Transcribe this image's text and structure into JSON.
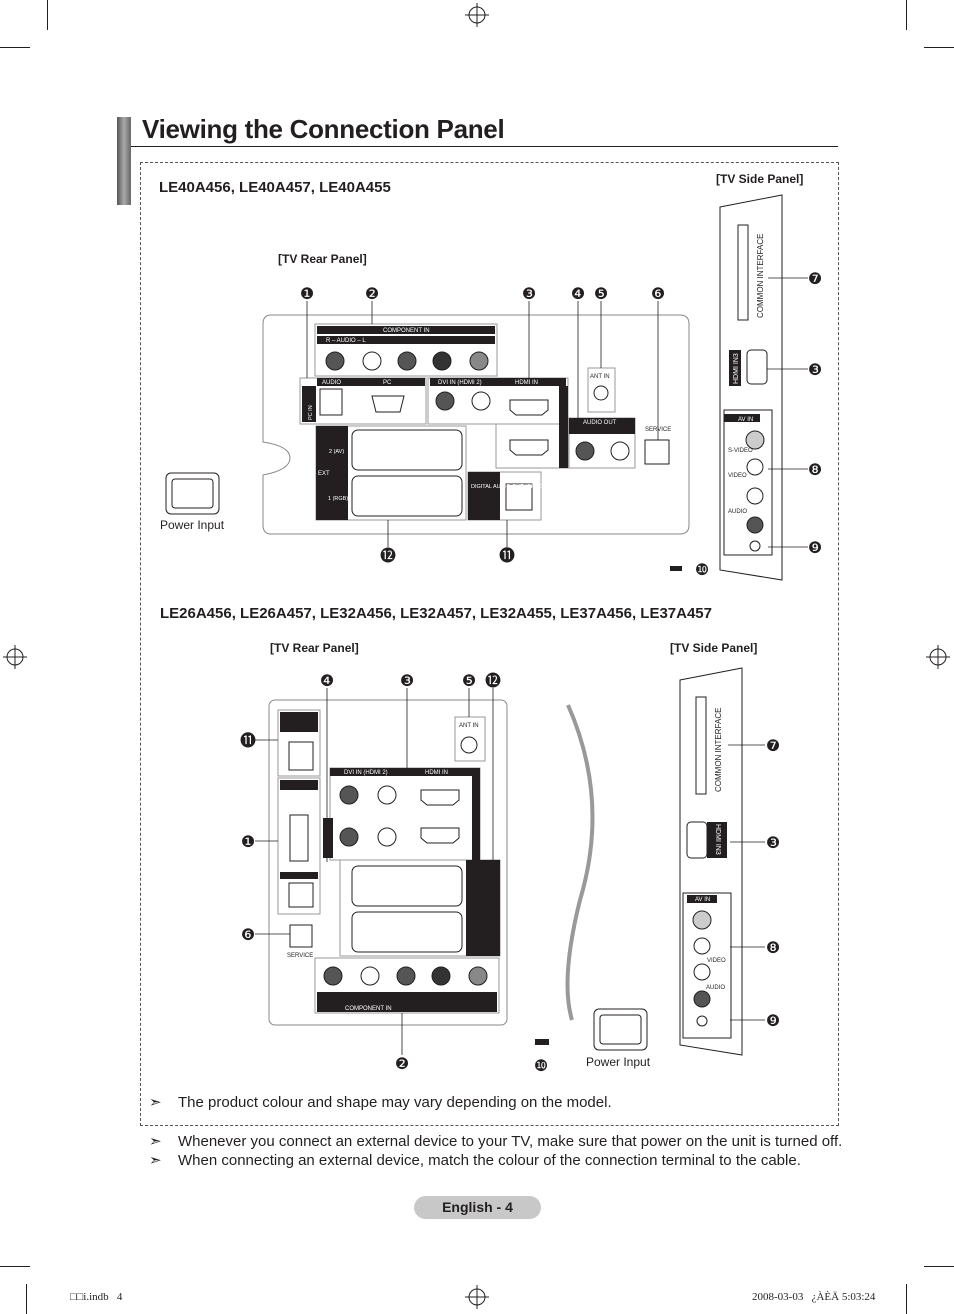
{
  "title": "Viewing the Connection Panel",
  "section1": {
    "models": "LE40A456, LE40A457, LE40A455",
    "side_panel_label": "[TV Side Panel]",
    "rear_panel_label": "[TV Rear Panel]",
    "power_input": "Power Input",
    "rear": {
      "component_in": "COMPONENT IN",
      "audio_rl": "R – AUDIO – L",
      "audio": "AUDIO",
      "pc": "PC",
      "pc_in": "PC IN",
      "dvi_in": "DVI IN (HDMI 2)",
      "hdmi_in": "HDMI IN",
      "ant_in": "ANT IN",
      "audio_out": "AUDIO OUT",
      "service": "SERVICE",
      "ext": "EXT",
      "ext2": "2 (AV)",
      "ext1": "1 (RGB)",
      "digital_audio_out": "DIGITAL AUDIO OUT (OPTICAL)"
    },
    "side": {
      "common_interface": "COMMON INTERFACE",
      "hdmi_in3": "HDMI IN3",
      "av_in": "AV IN",
      "s_video": "S-VIDEO",
      "video": "VIDEO",
      "audio": "AUDIO"
    }
  },
  "section2": {
    "models": "LE26A456, LE26A457, LE32A456, LE32A457, LE32A455, LE37A456, LE37A457",
    "rear_panel_label": "[TV Rear Panel]",
    "side_panel_label": "[TV Side Panel]",
    "power_input": "Power Input"
  },
  "callouts": [
    "❶",
    "❷",
    "❸",
    "❹",
    "❺",
    "❻",
    "❼",
    "❽",
    "❾",
    "❿",
    "⓫",
    "⓬"
  ],
  "notes": [
    "The product colour and shape may vary depending on the model.",
    "Whenever you connect an external device to your TV, make sure that power on the unit is turned off.",
    "When connecting an external device, match the colour of the connection terminal to the cable."
  ],
  "note_icon": "arrow-pointer-icon",
  "page_label": "English - 4",
  "footer": {
    "file": "□□i.indb   4",
    "timestamp": "2008-03-03   ¿ÀÈÄ 5:03:24"
  }
}
